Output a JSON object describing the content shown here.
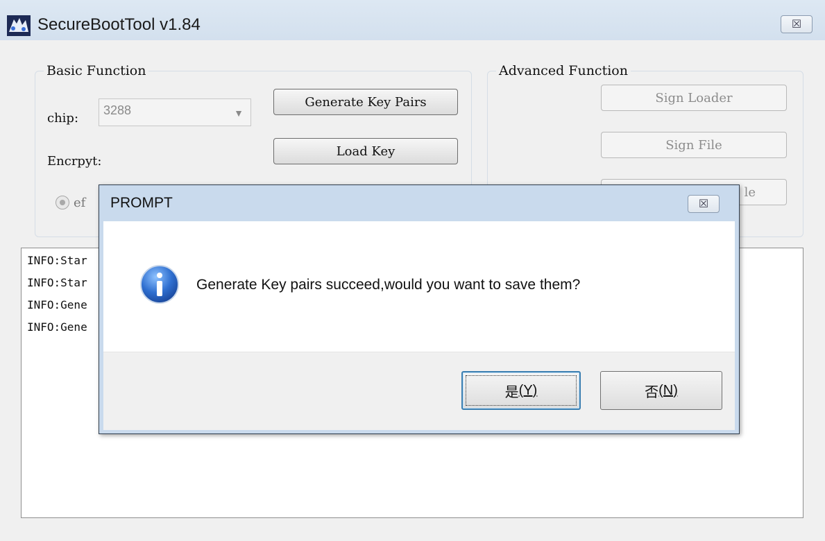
{
  "window": {
    "title": "SecureBootTool v1.84",
    "close_glyph": "☒"
  },
  "basic": {
    "legend": "Basic Function",
    "chip_label": "chip:",
    "chip_value": "3288",
    "encrypt_label": "Encrpyt:",
    "radio_label": "ef",
    "generate_button": "Generate Key Pairs",
    "load_key_button": "Load Key"
  },
  "advanced": {
    "legend": "Advanced Function",
    "sign_loader_button": "Sign Loader",
    "sign_file_button": "Sign File",
    "third_button_visible": "le"
  },
  "log": {
    "lines": [
      "INFO:Star",
      "INFO:Star",
      "INFO:Gene",
      "INFO:Gene"
    ]
  },
  "dialog": {
    "title": "PROMPT",
    "message": "Generate Key pairs succeed,would you want to save them?",
    "yes_label": "是",
    "yes_mnemonic": "(Y)",
    "no_label": "否",
    "no_mnemonic": "(N)",
    "icon": "info-icon"
  },
  "colors": {
    "titlebar": "#dde8f3",
    "dialog_frame": "#c9daed",
    "accent": "#3c7fb1"
  }
}
